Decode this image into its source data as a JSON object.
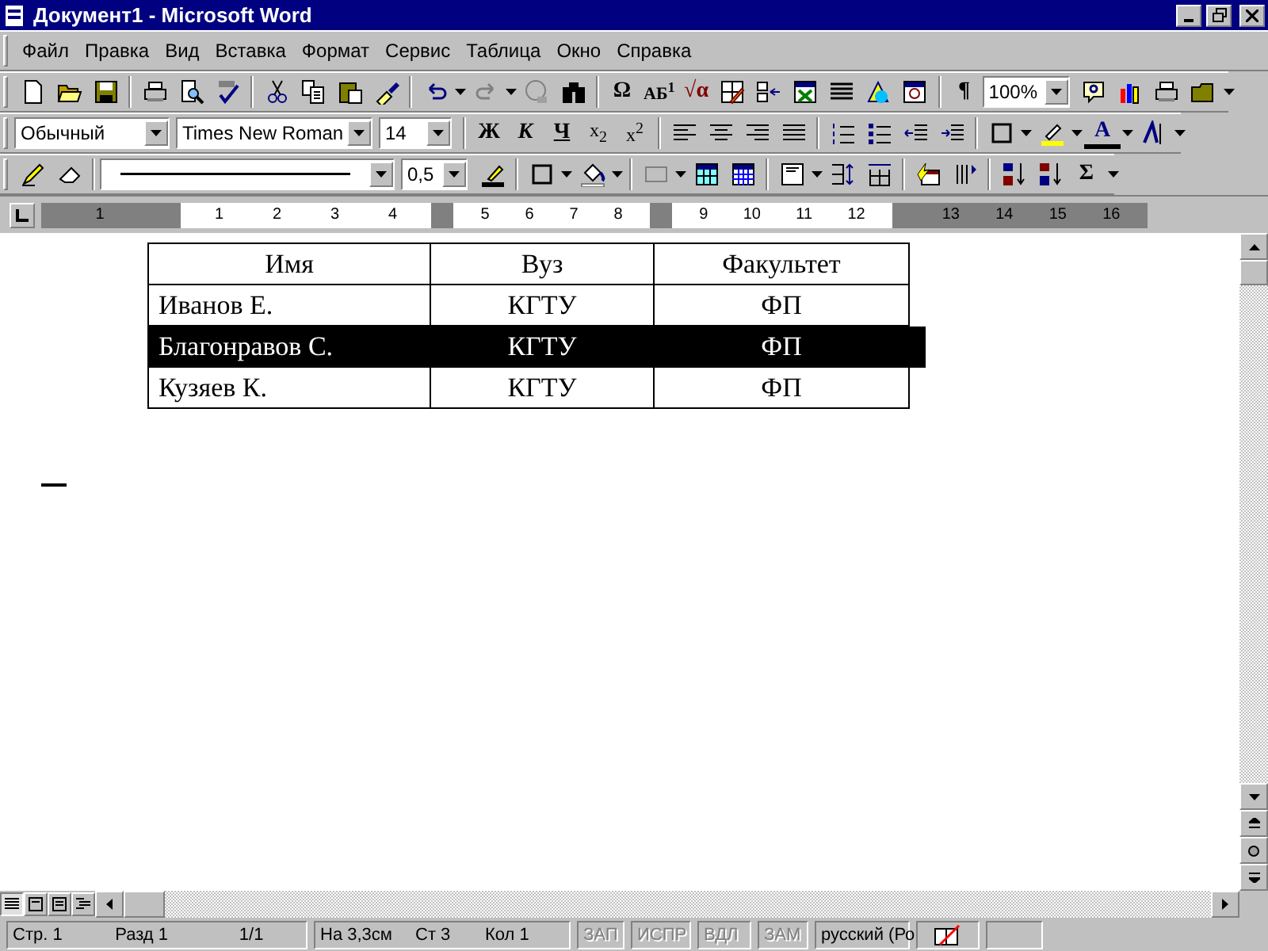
{
  "window": {
    "title": "Документ1 - Microsoft Word"
  },
  "menu": [
    "Файл",
    "Правка",
    "Вид",
    "Вставка",
    "Формат",
    "Сервис",
    "Таблица",
    "Окно",
    "Справка"
  ],
  "standard_toolbar": {
    "symbols": [
      {
        "kind": "symbol",
        "label": "Ω"
      },
      {
        "kind": "caps",
        "label": "АБ$^{1}$"
      },
      {
        "kind": "equation",
        "label": "√α"
      }
    ],
    "pilcrow": "¶",
    "zoom": "100%"
  },
  "formatting_toolbar": {
    "style": "Обычный",
    "font": "Times New Roman",
    "size": "14",
    "buttons": [
      {
        "kind": "bold",
        "label": "Ж"
      },
      {
        "kind": "italic",
        "label": "К"
      },
      {
        "kind": "underline",
        "label": "Ч"
      },
      {
        "kind": "subscript",
        "label": "x$_{2}$"
      },
      {
        "kind": "superscript",
        "label": "x$^{2}$"
      }
    ],
    "font_color": "A"
  },
  "tables_toolbar": {
    "line_weight": "0,5",
    "autosum": "Σ"
  },
  "ruler": [
    {
      "shaded": true,
      "numbers": [
        "1"
      ]
    },
    {
      "shaded": false,
      "numbers": [
        "1",
        "2",
        "3",
        "4"
      ]
    },
    {
      "shaded": false,
      "numbers": [
        "5",
        "6",
        "7",
        "8"
      ]
    },
    {
      "shaded": false,
      "numbers": [
        "9",
        "10",
        "11",
        "12"
      ]
    },
    {
      "shaded": true,
      "numbers": [
        "13",
        "14",
        "15",
        "16"
      ]
    }
  ],
  "table": {
    "header": [
      "Имя",
      "Вуз",
      "Факультет"
    ],
    "rows": [
      {
        "selected": false,
        "cells": [
          "Иванов Е.",
          "КГТУ",
          "ФП"
        ]
      },
      {
        "selected": true,
        "cells": [
          "Благонравов С.",
          "КГТУ",
          "ФП"
        ]
      },
      {
        "selected": false,
        "cells": [
          "Кузяев К.",
          "КГТУ",
          "ФП"
        ]
      }
    ]
  },
  "view_buttons": [
    {
      "selected": true
    },
    {
      "selected": false
    },
    {
      "selected": false
    },
    {
      "selected": false
    }
  ],
  "status_bar": {
    "position": [
      "Стр. 1",
      "Разд 1",
      "1/1"
    ],
    "cursor": [
      "На 3,3см",
      "Ст 3",
      "Кол 1"
    ],
    "modes": [
      {
        "label": "ЗАП",
        "disabled": true
      },
      {
        "label": "ИСПР",
        "disabled": true
      },
      {
        "label": "ВДЛ",
        "disabled": true
      },
      {
        "label": "ЗАМ",
        "disabled": true
      }
    ],
    "language": "русский (Ро"
  }
}
